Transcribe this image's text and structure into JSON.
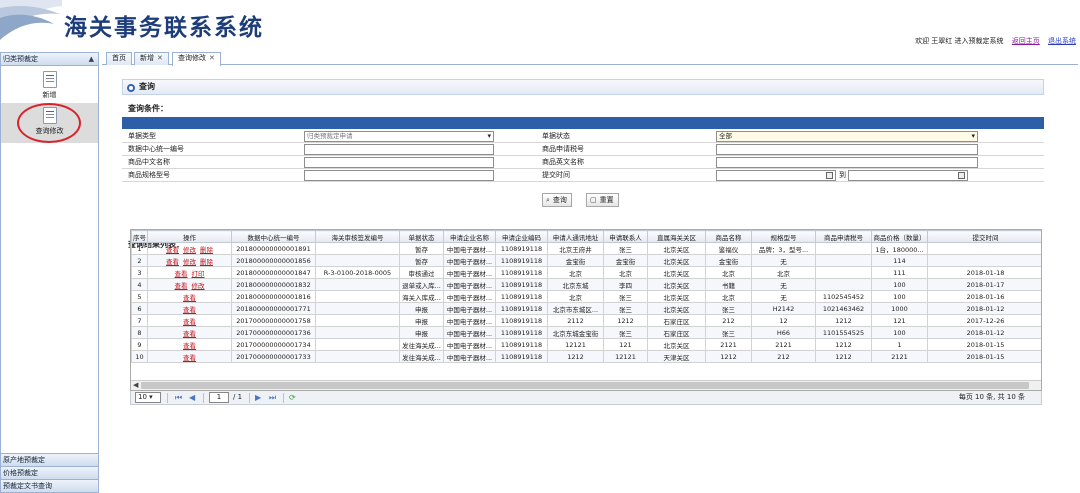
{
  "header": {
    "title": "海关事务联系系统",
    "welcome": "欢迎 王翠红 进入预裁定系统",
    "link_home": "返回主页",
    "link_logout": "退出系统"
  },
  "sidebar": {
    "section_title": "归类预裁定",
    "items": [
      {
        "label": "新增",
        "icon": "document-icon"
      },
      {
        "label": "查询修改",
        "icon": "document-icon"
      }
    ],
    "bottom": [
      "原产地预裁定",
      "价格预裁定",
      "预裁定文书查询"
    ]
  },
  "tabs": [
    {
      "label": "首页"
    },
    {
      "label": "新增"
    },
    {
      "label": "查询修改"
    }
  ],
  "query": {
    "panel_title": "查询",
    "conditions_label": "查询条件：",
    "fields": {
      "doc_type": {
        "label": "单据类型",
        "value": "归类预裁定申请"
      },
      "doc_status": {
        "label": "单据状态",
        "value": "全部"
      },
      "data_center_id": {
        "label": "数据中心统一编号",
        "value": ""
      },
      "goods_apply_no": {
        "label": "商品申请税号",
        "value": ""
      },
      "goods_cn_name": {
        "label": "商品中文名称",
        "value": ""
      },
      "goods_en_name": {
        "label": "商品英文名称",
        "value": ""
      },
      "goods_spec": {
        "label": "商品规格型号",
        "value": ""
      },
      "submit_time": {
        "label": "提交时间",
        "value_from": "",
        "value_to": "",
        "between": "到"
      }
    },
    "buttons": {
      "search": "查询",
      "reset": "重置"
    }
  },
  "results": {
    "label": "查询结果列表：",
    "columns": [
      "序号",
      "操作",
      "数据中心统一编号",
      "海关审核签发编号",
      "单据状态",
      "申请企业名称",
      "申请企业编码",
      "申请人通讯地址",
      "申请联系人",
      "直属海关关区",
      "商品名称",
      "规格型号",
      "商品申请税号",
      "商品价格（数量）",
      "提交时间"
    ],
    "rows": [
      {
        "no": "1",
        "actions": [
          "查看",
          "修改",
          "删除"
        ],
        "id": "201800000000001891",
        "approval": "",
        "status": "暂存",
        "company": "中国电子器材...",
        "code": "1108919118",
        "address": "北京王府井",
        "contact": "张三",
        "customs": "北京关区",
        "name": "鉴福仪",
        "spec": "品牌：3，型号...",
        "tax_no": "",
        "price": "1台，180000...",
        "time": ""
      },
      {
        "no": "2",
        "actions": [
          "查看",
          "修改",
          "删除"
        ],
        "id": "201800000000001856",
        "approval": "",
        "status": "暂存",
        "company": "中国电子器材...",
        "code": "1108919118",
        "address": "金宝街",
        "contact": "金宝街",
        "customs": "北京关区",
        "name": "金宝街",
        "spec": "无",
        "tax_no": "",
        "price": "114",
        "time": ""
      },
      {
        "no": "3",
        "actions": [
          "查看",
          "打印"
        ],
        "id": "201800000000001847",
        "approval": "R-3-0100-2018-0005",
        "status": "审核通过",
        "company": "中国电子器材...",
        "code": "1108919118",
        "address": "北京",
        "contact": "北京",
        "customs": "北京关区",
        "name": "北京",
        "spec": "北京",
        "tax_no": "",
        "price": "111",
        "time": "2018-01-18"
      },
      {
        "no": "4",
        "actions": [
          "查看",
          "修改"
        ],
        "id": "201800000000001832",
        "approval": "",
        "status": "退单或入库...",
        "company": "中国电子器材...",
        "code": "1108919118",
        "address": "北京东城",
        "contact": "李四",
        "customs": "北京关区",
        "name": "书籍",
        "spec": "无",
        "tax_no": "",
        "price": "100",
        "time": "2018-01-17"
      },
      {
        "no": "5",
        "actions": [
          "查看"
        ],
        "id": "201800000000001816",
        "approval": "",
        "status": "海关入库成...",
        "company": "中国电子器材...",
        "code": "1108919118",
        "address": "北京",
        "contact": "张三",
        "customs": "北京关区",
        "name": "北京",
        "spec": "无",
        "tax_no": "1102545452",
        "price": "100",
        "time": "2018-01-16"
      },
      {
        "no": "6",
        "actions": [
          "查看"
        ],
        "id": "201800000000001771",
        "approval": "",
        "status": "申报",
        "company": "中国电子器材...",
        "code": "1108919118",
        "address": "北京市东城区...",
        "contact": "张三",
        "customs": "北京关区",
        "name": "张三",
        "spec": "H2142",
        "tax_no": "1021463462",
        "price": "1000",
        "time": "2018-01-12"
      },
      {
        "no": "7",
        "actions": [
          "查看"
        ],
        "id": "201700000000001758",
        "approval": "",
        "status": "申报",
        "company": "中国电子器材...",
        "code": "1108919118",
        "address": "2112",
        "contact": "1212",
        "customs": "石家庄区",
        "name": "212",
        "spec": "12",
        "tax_no": "1212",
        "price": "121",
        "time": "2017-12-26"
      },
      {
        "no": "8",
        "actions": [
          "查看"
        ],
        "id": "201700000000001736",
        "approval": "",
        "status": "申报",
        "company": "中国电子器材...",
        "code": "1108919118",
        "address": "北京东城金宝街",
        "contact": "张三",
        "customs": "石家庄区",
        "name": "张三",
        "spec": "H66",
        "tax_no": "1101554525",
        "price": "100",
        "time": "2018-01-12"
      },
      {
        "no": "9",
        "actions": [
          "查看"
        ],
        "id": "201700000000001734",
        "approval": "",
        "status": "发往海关成...",
        "company": "中国电子器材...",
        "code": "1108919118",
        "address": "12121",
        "contact": "121",
        "customs": "北京关区",
        "name": "2121",
        "spec": "2121",
        "tax_no": "1212",
        "price": "1",
        "time": "2018-01-15"
      },
      {
        "no": "10",
        "actions": [
          "查看"
        ],
        "id": "201700000000001733",
        "approval": "",
        "status": "发往海关成...",
        "company": "中国电子器材...",
        "code": "1108919118",
        "address": "1212",
        "contact": "12121",
        "customs": "天津关区",
        "name": "1212",
        "spec": "212",
        "tax_no": "1212",
        "price": "2121",
        "time": "2018-01-15"
      }
    ]
  },
  "pager": {
    "page_size": "10",
    "current_page": "1",
    "total_pages": "/ 1",
    "info": "每页 10 条, 共 10 条"
  },
  "colors": {
    "accent": "#2d5fa9",
    "title": "#1d3d7a",
    "action_link": "#c0161d",
    "annotation_ring": "#d8232a"
  }
}
